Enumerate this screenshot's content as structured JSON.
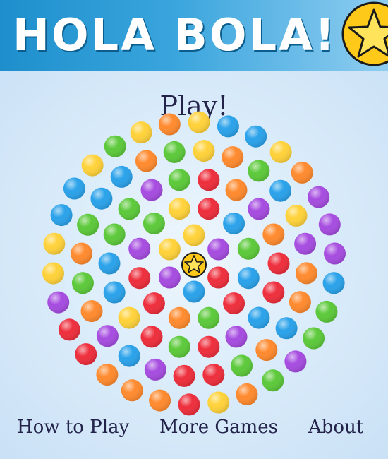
{
  "header": {
    "title": "HOLA BOLA!",
    "logo_icon": "star-coin-icon"
  },
  "play_label": "Play!",
  "nav": {
    "how_to_play": "How to Play",
    "more_games": "More Games",
    "about": "About"
  },
  "colors": {
    "green": "#5cc93a",
    "orange": "#ff8a2e",
    "yellow": "#ffd23a",
    "red": "#ee2e3c",
    "purple": "#a64ce0",
    "blue": "#2aa2ea",
    "header_start": "#1e8fcc",
    "star": "#ffc91a"
  },
  "board": {
    "center_icon": "star-icon",
    "rings": [
      [
        "yellow",
        "purple",
        "red",
        "blue",
        "purple",
        "yellow"
      ],
      [
        "red",
        "blue",
        "green",
        "blue",
        "red",
        "green",
        "orange",
        "red",
        "red",
        "purple",
        "green",
        "yellow"
      ],
      [
        "red",
        "orange",
        "purple",
        "orange",
        "red",
        "red",
        "blue",
        "purple",
        "red",
        "green",
        "red",
        "yellow",
        "blue",
        "blue",
        "green",
        "green",
        "purple",
        "green"
      ],
      [
        "yellow",
        "orange",
        "green",
        "blue",
        "yellow",
        "purple",
        "orange",
        "orange",
        "blue",
        "orange",
        "green",
        "red",
        "red",
        "purple",
        "blue",
        "purple",
        "orange",
        "green",
        "orange",
        "green",
        "blue",
        "blue",
        "orange",
        "green"
      ],
      [
        "yellow",
        "blue",
        "blue",
        "yellow",
        "orange",
        "purple",
        "purple",
        "purple",
        "blue",
        "green",
        "green",
        "purple",
        "green",
        "orange",
        "yellow",
        "red",
        "orange",
        "orange",
        "orange",
        "red",
        "red",
        "purple",
        "yellow",
        "yellow",
        "blue",
        "blue",
        "yellow",
        "green",
        "yellow",
        "orange"
      ]
    ]
  }
}
